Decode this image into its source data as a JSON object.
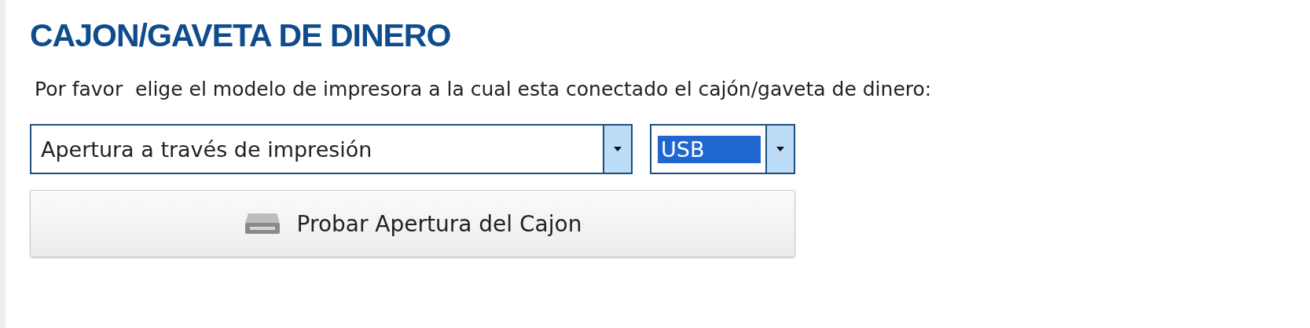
{
  "title": "CAJON/GAVETA DE DINERO",
  "instruction": "Por favor  elige el modelo de impresora a la cual esta conectado el cajón/gaveta de dinero:",
  "selects": [
    {
      "value": "Apertura a través de impresión",
      "highlighted": false
    },
    {
      "value": "USB",
      "highlighted": true
    }
  ],
  "test_button": {
    "label": "Probar Apertura del Cajon"
  }
}
